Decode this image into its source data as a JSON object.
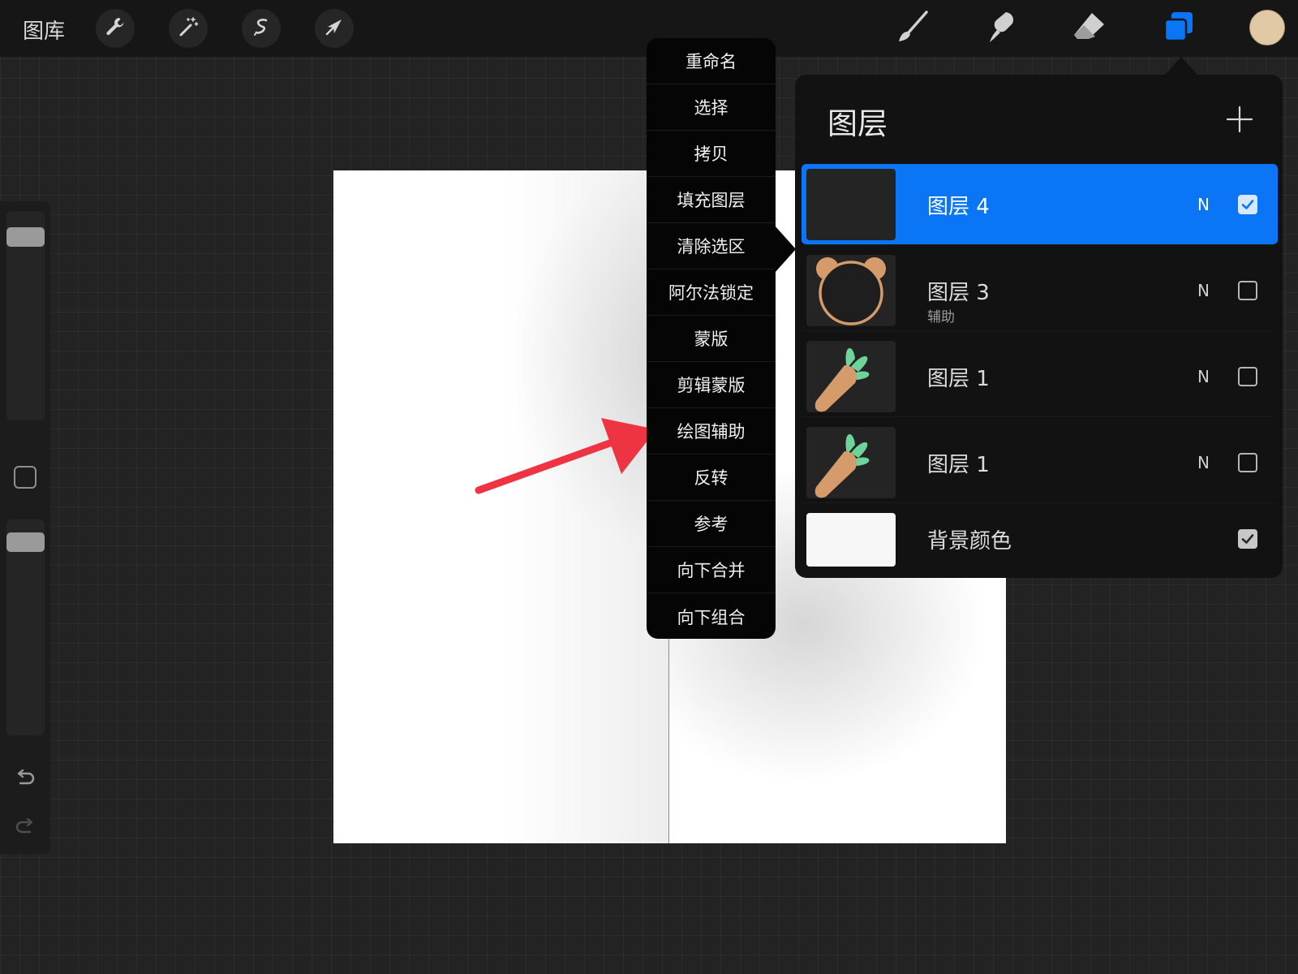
{
  "toolbar": {
    "gallery_label": "图库",
    "left_tools": [
      "wrench-icon",
      "magic-wand-icon",
      "selection-icon",
      "transform-arrow-icon"
    ],
    "right_tools": [
      "brush-icon",
      "smudge-icon",
      "eraser-icon",
      "layers-icon"
    ],
    "current_color": "#e2c9a6",
    "accent_color": "#0b76f5"
  },
  "layer_menu": {
    "items": [
      "重命名",
      "选择",
      "拷贝",
      "填充图层",
      "清除选区",
      "阿尔法锁定",
      "蒙版",
      "剪辑蒙版",
      "绘图辅助",
      "反转",
      "参考",
      "向下合并",
      "向下组合"
    ]
  },
  "layers_panel": {
    "title": "图层",
    "layers": [
      {
        "name": "图层 4",
        "sub": "",
        "blend": "N",
        "visible": true,
        "active": true
      },
      {
        "name": "图层 3",
        "sub": "辅助",
        "blend": "N",
        "visible": false,
        "active": false
      },
      {
        "name": "图层 1",
        "sub": "",
        "blend": "N",
        "visible": false,
        "active": false
      },
      {
        "name": "图层 1",
        "sub": "",
        "blend": "N",
        "visible": false,
        "active": false
      },
      {
        "name": "背景颜色",
        "sub": "",
        "blend": "",
        "visible": true,
        "active": false
      }
    ]
  }
}
